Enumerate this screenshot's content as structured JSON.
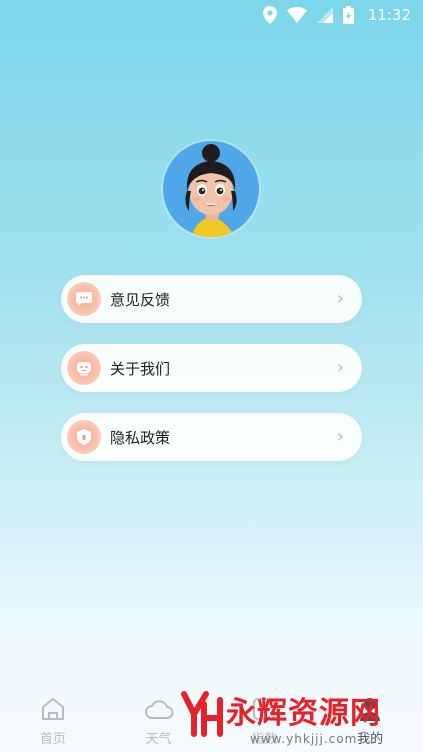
{
  "status_bar": {
    "time": "11:32",
    "icons": [
      "location-icon",
      "wifi-icon",
      "signal-icon",
      "battery-icon"
    ]
  },
  "profile": {
    "avatar": "avatar-cartoon-girl"
  },
  "menu": [
    {
      "label": "意见反馈",
      "icon": "feedback-icon"
    },
    {
      "label": "关于我们",
      "icon": "robot-face-icon"
    },
    {
      "label": "隐私政策",
      "icon": "shield-icon"
    }
  ],
  "tabbar": {
    "tabs": [
      {
        "label": "首页",
        "icon": "home-icon"
      },
      {
        "label": "天气",
        "icon": "cloud-icon"
      },
      {
        "label": "指数",
        "icon": "index-icon"
      },
      {
        "label": "我的",
        "icon": "profile-icon"
      }
    ]
  },
  "watermark": {
    "text": "永辉资源网",
    "url": "www.yhkjjj.com"
  },
  "colors": {
    "accent_orange": "#f7a98c",
    "watermark_red": "#e5222a"
  }
}
